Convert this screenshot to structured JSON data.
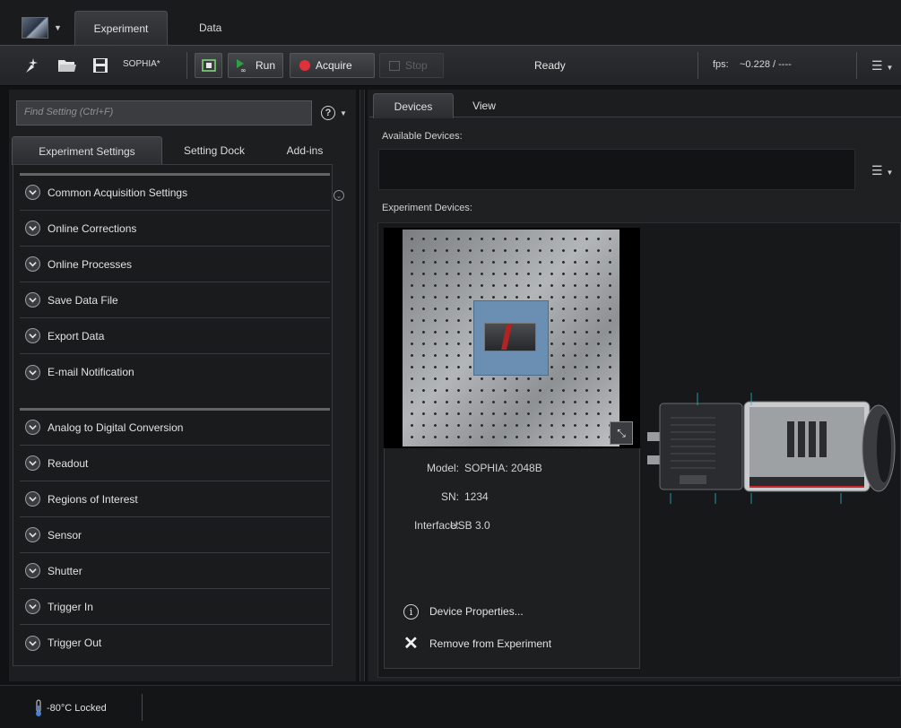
{
  "app": {
    "tabs": [
      {
        "label": "Experiment"
      },
      {
        "label": "Data"
      }
    ]
  },
  "toolbar": {
    "experiment_name": "SOPHIA*",
    "run_label": "Run",
    "acquire_label": "Acquire",
    "stop_label": "Stop",
    "status": "Ready",
    "fps_label": "fps:",
    "fps_value": "~0.228 / ----",
    "accent_run": "#2ea043",
    "accent_acquire": "#e0303a"
  },
  "left_panel": {
    "search_placeholder": "Find Setting (Ctrl+F)",
    "tabs": [
      {
        "label": "Experiment Settings"
      },
      {
        "label": "Setting Dock"
      },
      {
        "label": "Add-ins"
      }
    ],
    "group1": [
      {
        "label": "Common Acquisition Settings"
      },
      {
        "label": "Online Corrections"
      },
      {
        "label": "Online Processes"
      },
      {
        "label": "Save Data File"
      },
      {
        "label": "Export Data"
      },
      {
        "label": "E-mail Notification"
      }
    ],
    "group2": [
      {
        "label": "Analog to Digital Conversion"
      },
      {
        "label": "Readout"
      },
      {
        "label": "Regions of Interest"
      },
      {
        "label": "Sensor"
      },
      {
        "label": "Shutter"
      },
      {
        "label": "Trigger In"
      },
      {
        "label": "Trigger Out"
      }
    ]
  },
  "right_panel": {
    "tabs": [
      {
        "label": "Devices"
      },
      {
        "label": "View"
      }
    ],
    "available_label": "Available Devices:",
    "experiment_label": "Experiment Devices:",
    "device": {
      "model_key": "Model:",
      "model_value": "SOPHIA: 2048B",
      "sn_key": "SN:",
      "sn_value": "1234",
      "interface_key": "Interface:",
      "interface_value": "USB 3.0",
      "properties_label": "Device Properties...",
      "remove_label": "Remove from Experiment"
    }
  },
  "statusbar": {
    "temperature": "-80°C Locked"
  }
}
